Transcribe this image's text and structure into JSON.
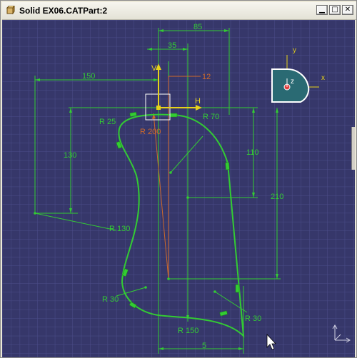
{
  "window": {
    "title": "Solid EX06.CATPart:2",
    "minimize_glyph": "▁",
    "maximize_glyph": "□",
    "close_glyph": "✕"
  },
  "sketch": {
    "dimensions": {
      "d85": "85",
      "d35": "35",
      "d150": "150",
      "d12": "12",
      "r25": "R 25",
      "r200": "R 200",
      "r70": "R 70",
      "d130": "130",
      "d110": "110",
      "d210": "210",
      "r130": "R 130",
      "r30_left": "R 30",
      "r30_right": "R 30",
      "r150": "R 150",
      "d5": "5"
    },
    "axis_labels": {
      "v": "V",
      "h": "H"
    }
  },
  "compass": {
    "y_label": "y",
    "x_label": "x",
    "z_label": "z"
  },
  "colors": {
    "background": "#36376a",
    "grid": "#4a4b86",
    "geometry": "#33cc33",
    "construction_orange": "#d06a2a",
    "axis_yellow": "#e6d21a"
  }
}
